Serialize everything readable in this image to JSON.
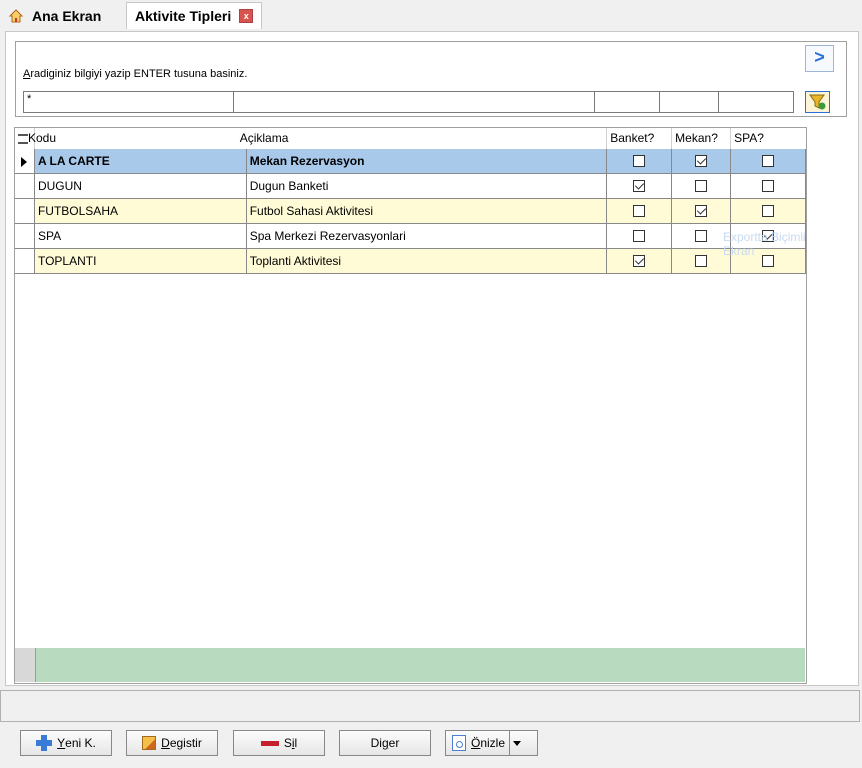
{
  "tabs": {
    "home_label": "Ana Ekran",
    "active_label": "Aktivite Tipleri",
    "close_symbol": "x"
  },
  "search": {
    "hint": "Aradiginiz bilgiyi yazip ENTER tusuna basiniz.",
    "hint_underlined_char": "A",
    "hint_rest": "radiginiz bilgiyi yazip ENTER tusuna basiniz.",
    "filter_value": "*",
    "nav_symbol": ">"
  },
  "grid": {
    "columns": {
      "kodu": "Kodu",
      "aciklama": "Açiklama",
      "banket": "Banket?",
      "mekan": "Mekan?",
      "spa": "SPA?"
    },
    "rows": [
      {
        "kodu": "A LA CARTE",
        "aciklama": "Mekan Rezervasyon",
        "banket": false,
        "mekan": true,
        "spa": false
      },
      {
        "kodu": "DUGUN",
        "aciklama": "Dugun Banketi",
        "banket": true,
        "mekan": false,
        "spa": false
      },
      {
        "kodu": "FUTBOLSAHA",
        "aciklama": "Futbol Sahasi Aktivitesi",
        "banket": false,
        "mekan": true,
        "spa": false
      },
      {
        "kodu": "SPA",
        "aciklama": "Spa Merkezi Rezervasyonlari",
        "banket": false,
        "mekan": false,
        "spa": true
      },
      {
        "kodu": "TOPLANTI",
        "aciklama": "Toplanti Aktivitesi",
        "banket": true,
        "mekan": false,
        "spa": false
      }
    ],
    "ghost_text": "Exportta Biçimli Ekran"
  },
  "toolbar": {
    "new": {
      "u": "Y",
      "rest": "eni K."
    },
    "edit": {
      "u": "D",
      "rest": "egistir"
    },
    "delete": {
      "pre": "S",
      "u": "i",
      "rest": "l"
    },
    "other": {
      "pre": "Di",
      "u": "g",
      "rest": "er"
    },
    "preview": {
      "u": "Ö",
      "rest": "nizle"
    }
  },
  "colors": {
    "selected_row": "#a9c9ea",
    "alt_row": "#fffbd6",
    "footer_bar": "#b8dbc0",
    "accent": "#2a6fd6"
  }
}
